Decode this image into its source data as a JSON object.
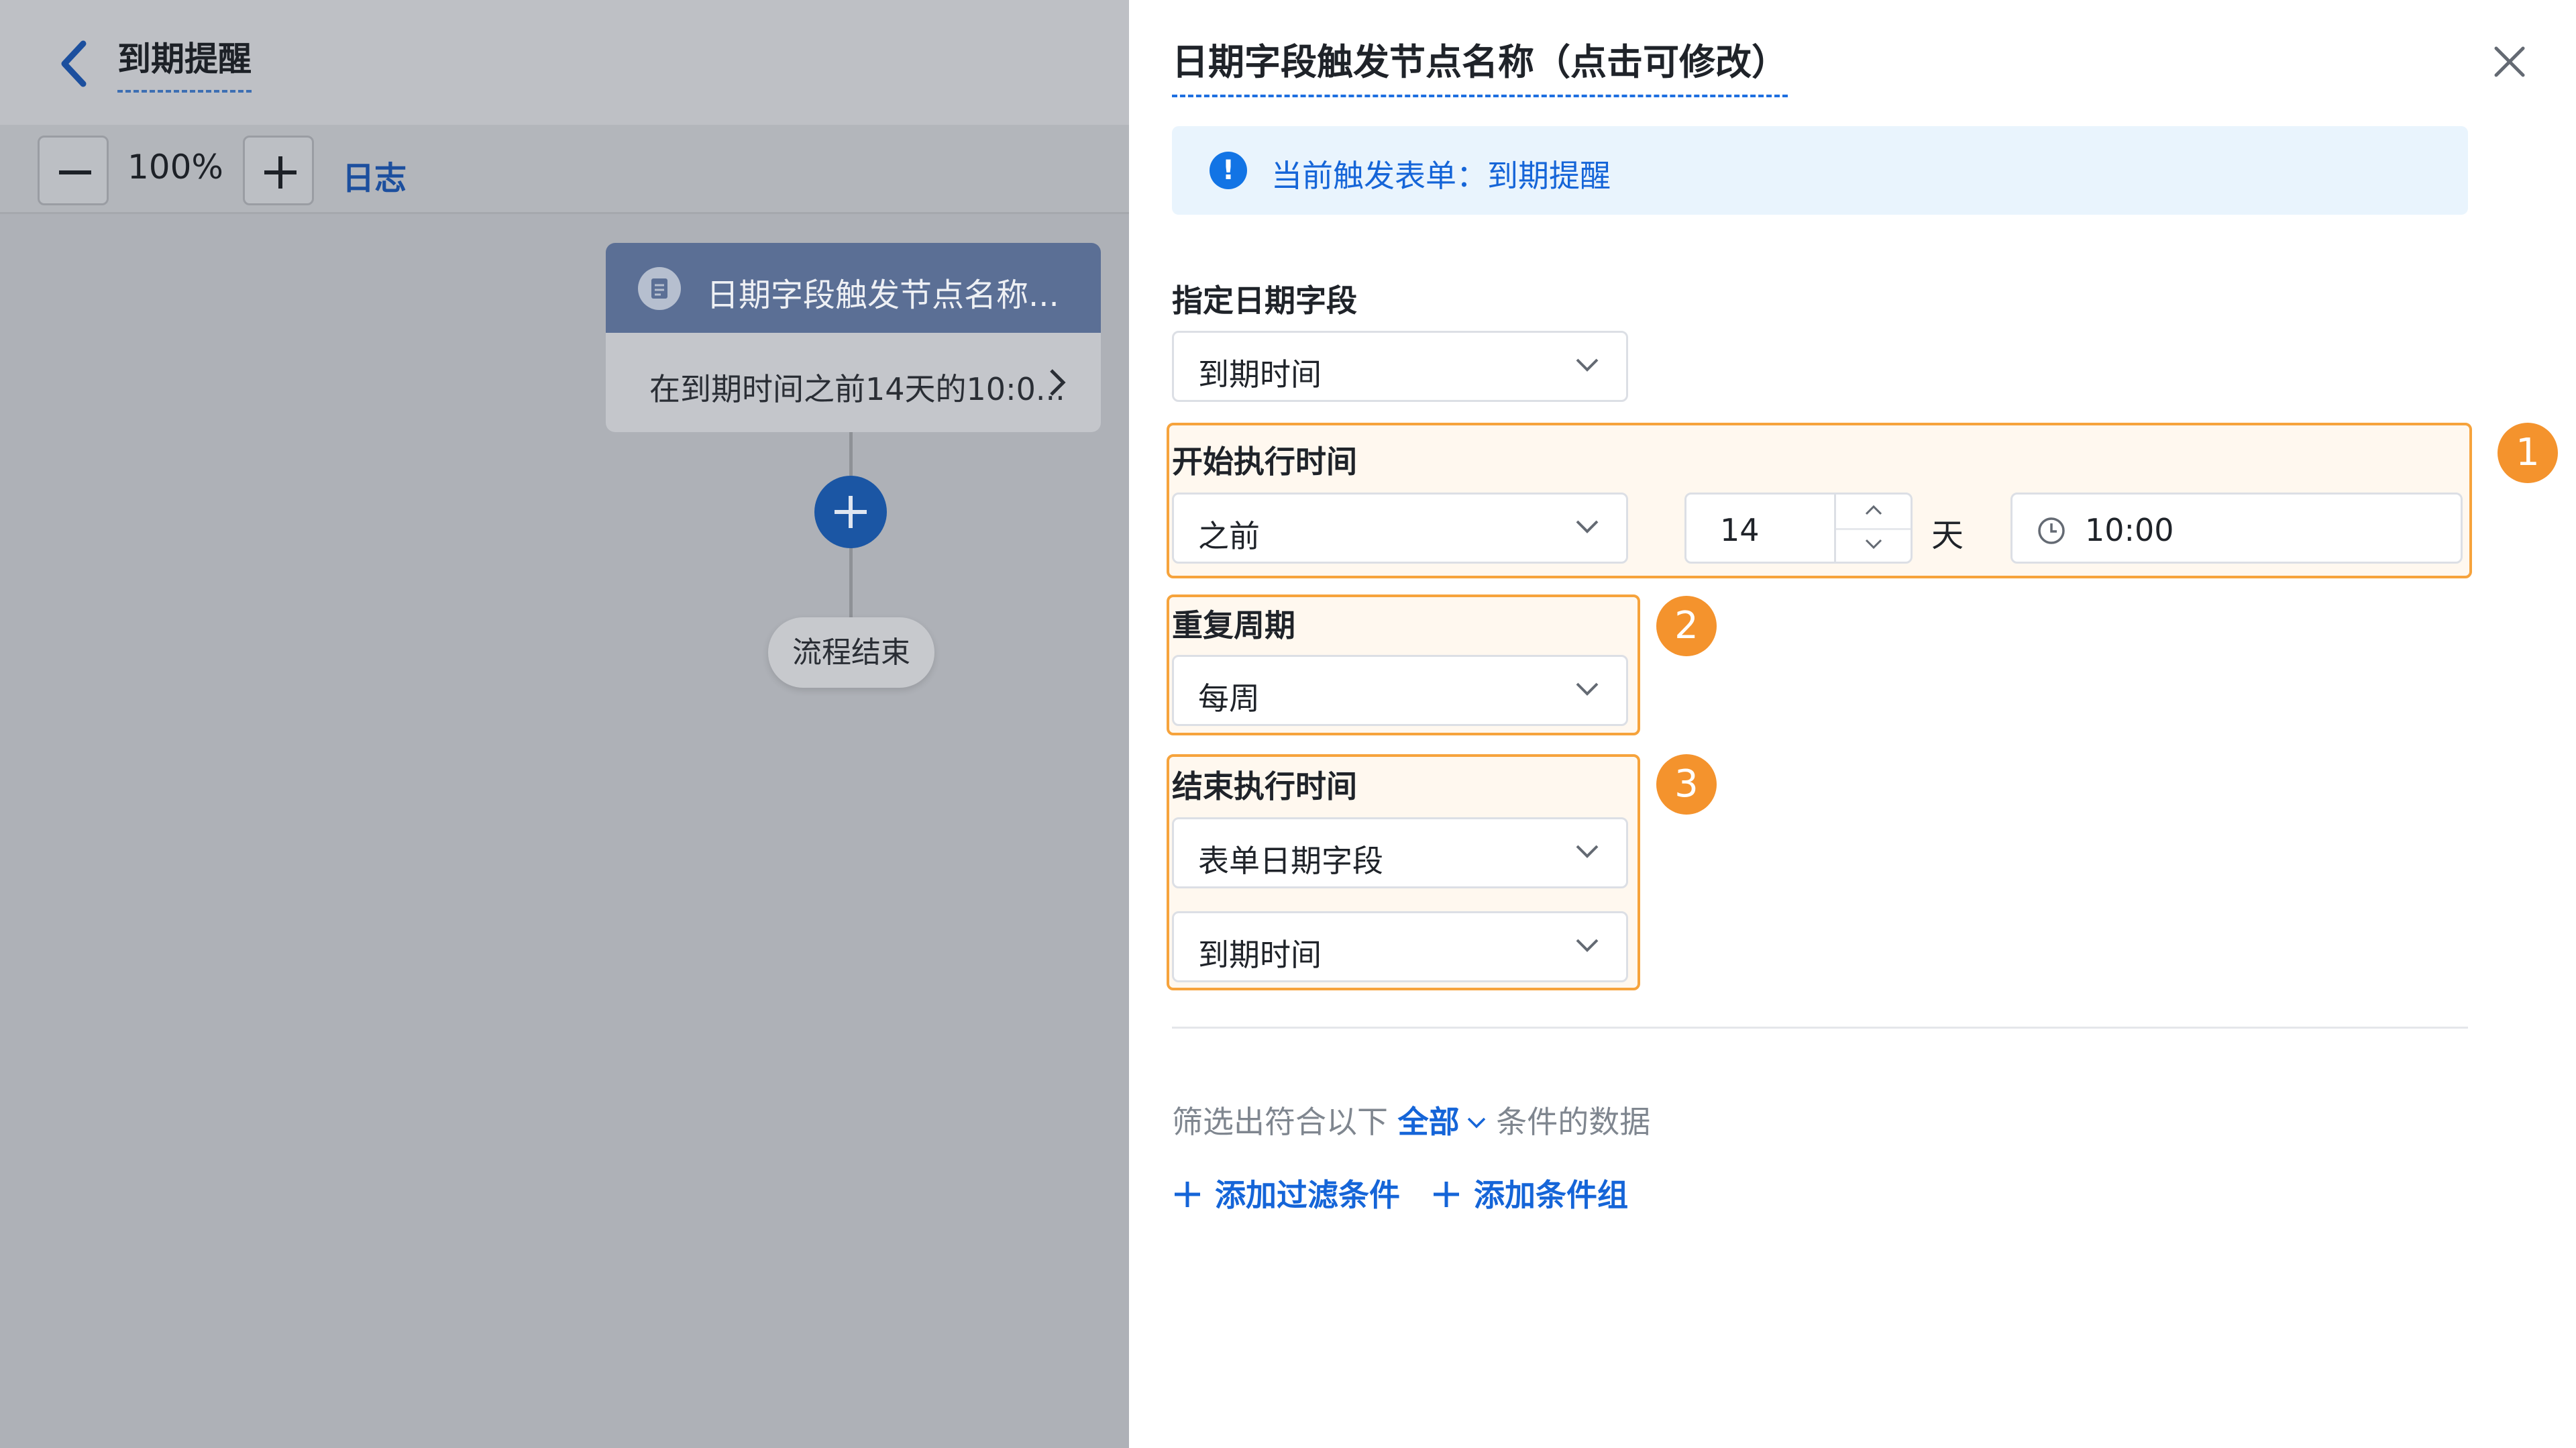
{
  "flow": {
    "title": "到期提醒",
    "zoom": "100%",
    "log_label": "日志",
    "node": {
      "title": "日期字段触发节点名称...",
      "description": "在到期时间之前14天的10:0..."
    },
    "end_label": "流程结束"
  },
  "panel": {
    "title": "日期字段触发节点名称（点击可修改）",
    "info": "当前触发表单：到期提醒",
    "date_field": {
      "label": "指定日期字段",
      "value": "到期时间"
    },
    "start": {
      "label": "开始执行时间",
      "badge": "1",
      "direction": "之前",
      "days": "14",
      "unit": "天",
      "time": "10:00"
    },
    "repeat": {
      "label": "重复周期",
      "badge": "2",
      "value": "每周"
    },
    "end": {
      "label": "结束执行时间",
      "badge": "3",
      "type_value": "表单日期字段",
      "field_value": "到期时间"
    },
    "filter": {
      "prefix": "筛选出符合以下",
      "mode": "全部",
      "suffix": "条件的数据",
      "add_condition": "添加过滤条件",
      "add_group": "添加条件组"
    }
  },
  "colors": {
    "accent": "#1565d8",
    "highlight": "#f4932d",
    "info_bg": "#e9f4fd"
  }
}
